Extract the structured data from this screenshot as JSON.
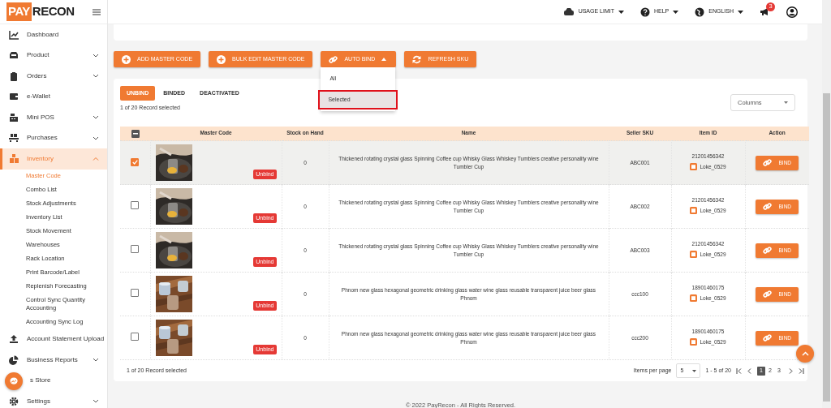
{
  "app": {
    "logo_left": "PAY",
    "logo_right": "RECON"
  },
  "topbar": {
    "items": [
      {
        "kind": "usage",
        "label": "USAGE LIMIT"
      },
      {
        "kind": "help",
        "label": "HELP"
      },
      {
        "kind": "language",
        "label": "ENGLISH"
      }
    ],
    "notification_count": "3"
  },
  "sidebar": {
    "items": [
      {
        "label": "Dashboard",
        "selected": false
      },
      {
        "label": "Product",
        "expanded": false,
        "selected": false
      },
      {
        "label": "Orders",
        "expanded": false,
        "selected": false
      },
      {
        "label": "e-Wallet",
        "selected": false
      },
      {
        "label": "Mini POS",
        "expanded": false,
        "selected": false
      },
      {
        "label": "Purchases",
        "expanded": false,
        "selected": false
      },
      {
        "label": "Inventory",
        "expanded": true,
        "selected": true,
        "children": [
          {
            "label": "Master Code",
            "selected": true
          },
          {
            "label": "Combo List",
            "selected": false
          },
          {
            "label": "Stock Adjustments",
            "selected": false
          },
          {
            "label": "Inventory List",
            "selected": false
          },
          {
            "label": "Stock Movement",
            "selected": false
          },
          {
            "label": "Warehouses",
            "selected": false
          },
          {
            "label": "Rack Location",
            "selected": false
          },
          {
            "label": "Print Barcode/Label",
            "selected": false
          },
          {
            "label": "Replenish Forecasting",
            "selected": false
          },
          {
            "label": "Control Sync Quantity Accounting",
            "selected": false
          },
          {
            "label": "Accounting Sync Log",
            "selected": false
          }
        ]
      },
      {
        "label": "Account Statement Upload",
        "selected": false
      },
      {
        "label": "Business Reports",
        "expanded": false,
        "selected": false
      },
      {
        "label": "s Store",
        "selected": false
      },
      {
        "label": "Settings",
        "expanded": false,
        "selected": false
      }
    ]
  },
  "toolbar": {
    "buttons": [
      {
        "kind": "add",
        "label": "ADD MASTER CODE"
      },
      {
        "kind": "add",
        "label": "BULK EDIT MASTER CODE"
      },
      {
        "kind": "link",
        "label": "AUTO BIND",
        "expanded": true,
        "menu": [
          {
            "label": "All",
            "selected": false
          },
          {
            "label": "Selected",
            "selected": true
          }
        ]
      },
      {
        "kind": "refresh",
        "label": "REFRESH SKU"
      }
    ]
  },
  "tabs": [
    {
      "label": "UNBIND",
      "selected": true
    },
    {
      "label": "BINDED",
      "selected": false
    },
    {
      "label": "DEACTIVATED",
      "selected": false
    }
  ],
  "selection_text": "1 of 20 Record selected",
  "columns_select": {
    "placeholder": "Columns"
  },
  "table": {
    "select_all": {
      "indeterminate": true
    },
    "columns": [
      "Master Code",
      "Stock on Hand",
      "Name",
      "Seller SKU",
      "Item ID",
      "Action"
    ],
    "rows": [
      {
        "checked": true,
        "status": "Unbind",
        "stock": "0",
        "name": "Thickened rotating crystal glass Spinning Coffee cup Whisky Glass Whiskey Tumblers creative personality wine Tumbler Cup",
        "sku": "ABC001",
        "item_id": "21201456342",
        "shop": "Loke_0529",
        "action": "BIND"
      },
      {
        "checked": false,
        "status": "Unbind",
        "stock": "0",
        "name": "Thickened rotating crystal glass Spinning Coffee cup Whisky Glass Whiskey Tumblers creative personality wine Tumbler Cup",
        "sku": "ABC002",
        "item_id": "21201456342",
        "shop": "Loke_0529",
        "action": "BIND"
      },
      {
        "checked": false,
        "status": "Unbind",
        "stock": "0",
        "name": "Thickened rotating crystal glass Spinning Coffee cup Whisky Glass Whiskey Tumblers creative personality wine Tumbler Cup",
        "sku": "ABC003",
        "item_id": "21201456342",
        "shop": "Loke_0529",
        "action": "BIND"
      },
      {
        "checked": false,
        "status": "Unbind",
        "stock": "0",
        "name": "Phnom new glass hexagonal geometric drinking glass water wine glass reusable transparent juice beer glass Phnom",
        "sku": "ccc100",
        "item_id": "18901460175",
        "shop": "Loke_0529",
        "action": "BIND"
      },
      {
        "checked": false,
        "status": "Unbind",
        "stock": "0",
        "name": "Phnom new glass hexagonal geometric drinking glass water wine glass reusable transparent juice beer glass Phnom",
        "sku": "ccc200",
        "item_id": "18901460175",
        "shop": "Loke_0529",
        "action": "BIND"
      }
    ]
  },
  "footer": {
    "selection_text": "1 of 20 Record selected",
    "items_per_page_label": "Items per page",
    "items_per_page": "5",
    "range": "1 - 5 of 20",
    "pages": [
      {
        "label": "1",
        "selected": true
      },
      {
        "label": "2",
        "selected": false
      },
      {
        "label": "3",
        "selected": false
      }
    ]
  },
  "copyright": "© 2022 PayRecon - All Rights Reserved."
}
